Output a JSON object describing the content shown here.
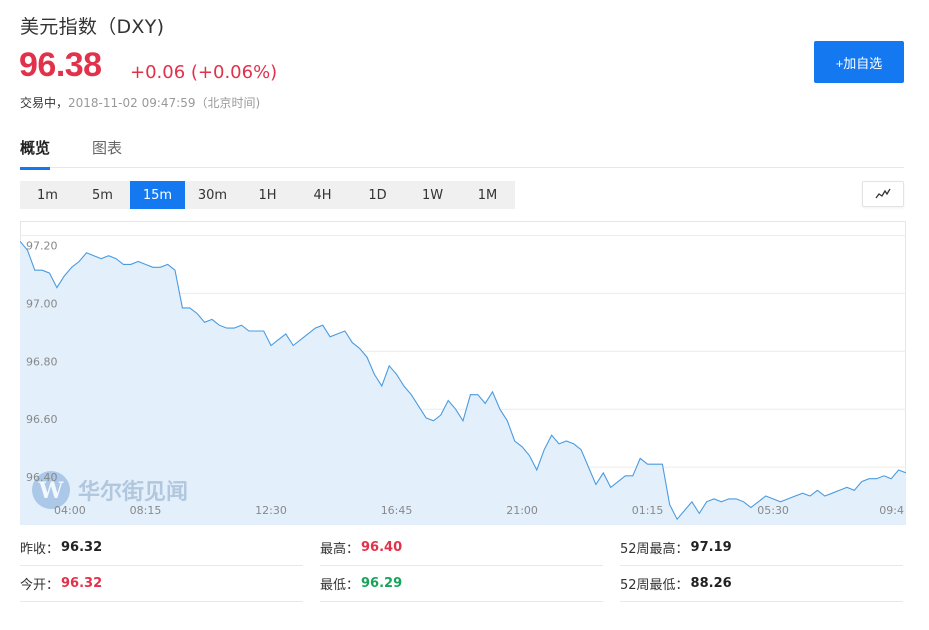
{
  "header": {
    "title": "美元指数（DXY)",
    "price": "96.38",
    "change": "+0.06 (+0.06%)",
    "status": "交易中，",
    "timestamp": "2018-11-02 09:47:59（北京时间)"
  },
  "actions": {
    "watchlist_label": "+加自选"
  },
  "tabs": [
    {
      "label": "概览",
      "active": true
    },
    {
      "label": "图表",
      "active": false
    }
  ],
  "periods": [
    {
      "label": "1m"
    },
    {
      "label": "5m"
    },
    {
      "label": "15m",
      "active": true
    },
    {
      "label": "30m"
    },
    {
      "label": "1H"
    },
    {
      "label": "4H"
    },
    {
      "label": "1D"
    },
    {
      "label": "1W"
    },
    {
      "label": "1M"
    }
  ],
  "chart_type_icon": "line-chart-icon",
  "watermark": "华尔街见闻",
  "colors": {
    "up": "#e2314a",
    "down": "#1aa35a",
    "accent": "#1478f0",
    "line": "#4a9be0",
    "area": "#e1effc"
  },
  "chart_data": {
    "type": "area",
    "ylim": [
      96.2,
      97.25
    ],
    "yticks": [
      "97.20",
      "97.00",
      "96.80",
      "96.60",
      "96.40",
      "96.20"
    ],
    "xtick_labels": [
      "04:00",
      "08:15",
      "12:30",
      "16:45",
      "21:00",
      "01:15",
      "05:30",
      "09:4"
    ],
    "xtick_index": [
      0,
      17,
      34,
      51,
      68,
      85,
      102,
      119
    ],
    "grid": true,
    "values": [
      97.18,
      97.15,
      97.08,
      97.08,
      97.07,
      97.02,
      97.06,
      97.09,
      97.11,
      97.14,
      97.13,
      97.12,
      97.13,
      97.12,
      97.1,
      97.1,
      97.11,
      97.1,
      97.09,
      97.09,
      97.1,
      97.08,
      96.95,
      96.95,
      96.93,
      96.9,
      96.91,
      96.89,
      96.88,
      96.88,
      96.89,
      96.87,
      96.87,
      96.87,
      96.82,
      96.84,
      96.86,
      96.82,
      96.84,
      96.86,
      96.88,
      96.89,
      96.85,
      96.86,
      96.87,
      96.83,
      96.81,
      96.78,
      96.72,
      96.68,
      96.75,
      96.72,
      96.68,
      96.65,
      96.61,
      96.57,
      96.56,
      96.58,
      96.63,
      96.6,
      96.56,
      96.65,
      96.65,
      96.62,
      96.66,
      96.6,
      96.56,
      96.49,
      96.47,
      96.44,
      96.39,
      96.46,
      96.51,
      96.48,
      96.49,
      96.48,
      96.46,
      96.4,
      96.34,
      96.38,
      96.33,
      96.35,
      96.37,
      96.37,
      96.43,
      96.41,
      96.41,
      96.41,
      96.27,
      96.22,
      96.25,
      96.28,
      96.24,
      96.28,
      96.29,
      96.28,
      96.29,
      96.29,
      96.28,
      96.26,
      96.28,
      96.3,
      96.29,
      96.28,
      96.29,
      96.3,
      96.31,
      96.3,
      96.32,
      96.3,
      96.31,
      96.32,
      96.33,
      96.32,
      96.35,
      96.36,
      96.36,
      96.37,
      96.36,
      96.39,
      96.38
    ]
  },
  "stats": [
    {
      "label": "昨收：",
      "value": "96.32",
      "color": "black"
    },
    {
      "label": "最高：",
      "value": "96.40",
      "color": "red"
    },
    {
      "label": "52周最高：",
      "value": "97.19",
      "color": "black"
    },
    {
      "label": "今开：",
      "value": "96.32",
      "color": "red"
    },
    {
      "label": "最低：",
      "value": "96.29",
      "color": "green"
    },
    {
      "label": "52周最低：",
      "value": "88.26",
      "color": "black"
    }
  ]
}
